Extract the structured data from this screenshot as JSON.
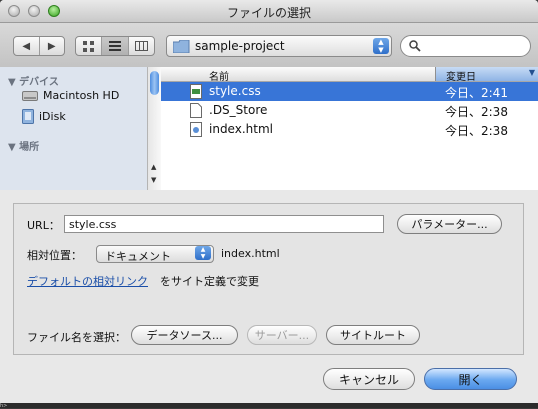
{
  "window": {
    "title": "ファイルの選択"
  },
  "toolbar": {
    "location_popup": {
      "value": "sample-project"
    },
    "search": {
      "placeholder": ""
    },
    "view_mode_selected": "list"
  },
  "sidebar": {
    "sections": [
      {
        "title": "▼ デバイス",
        "items": [
          "Macintosh HD",
          "iDisk"
        ]
      },
      {
        "title": "▼ 場所",
        "items": []
      }
    ]
  },
  "file_list": {
    "columns": {
      "name": "名前",
      "date": "変更日"
    },
    "rows": [
      {
        "name": "style.css",
        "date": "今日、2:41",
        "selected": true,
        "type": "css"
      },
      {
        "name": ".DS_Store",
        "date": "今日、2:38",
        "selected": false,
        "type": "file"
      },
      {
        "name": "index.html",
        "date": "今日、2:38",
        "selected": false,
        "type": "html"
      }
    ]
  },
  "options": {
    "url_label": "URL：",
    "url_value": "style.css",
    "params_button": "パラメーター...",
    "relative_label": "相対位置：",
    "relative_value": "ドキュメント",
    "relative_file": "index.html",
    "link_text": "デフォルトの相対リンク",
    "link_suffix": "をサイト定義で変更",
    "choose_label": "ファイル名を選択：",
    "datasource_button": "データソース...",
    "server_button": "サーバー...",
    "siteroot_button": "サイトルート"
  },
  "actions": {
    "cancel": "キャンセル",
    "open": "開く"
  },
  "background": {
    "strip_text": "h>"
  },
  "colors": {
    "selection": "#3875d7",
    "primary_button": "#6aa8f0",
    "link": "#1a4ea8"
  }
}
